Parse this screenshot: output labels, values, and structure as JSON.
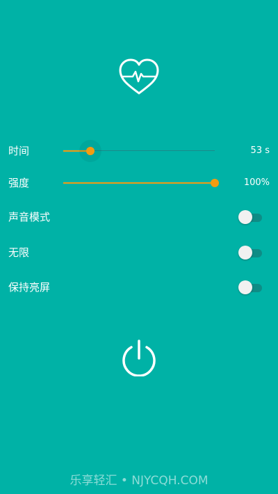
{
  "settings": [
    {
      "key": "time",
      "label": "时间",
      "type": "slider",
      "value_text": "53 s",
      "level": 0.18
    },
    {
      "key": "intensity",
      "label": "强度",
      "type": "slider",
      "value_text": "100%",
      "level": 1.0
    },
    {
      "key": "sound_mode",
      "label": "声音模式",
      "type": "toggle",
      "on": false
    },
    {
      "key": "unlimited",
      "label": "无限",
      "type": "toggle",
      "on": false
    },
    {
      "key": "keep_screen_on",
      "label": "保持亮屏",
      "type": "toggle",
      "on": false
    }
  ],
  "icons": {
    "header": "heart-pulse-icon",
    "action": "power-icon"
  },
  "watermark": "乐享轻汇 • NJYCQH.COM",
  "colors": {
    "background": "#00B2A6",
    "accent": "#F39C12"
  }
}
